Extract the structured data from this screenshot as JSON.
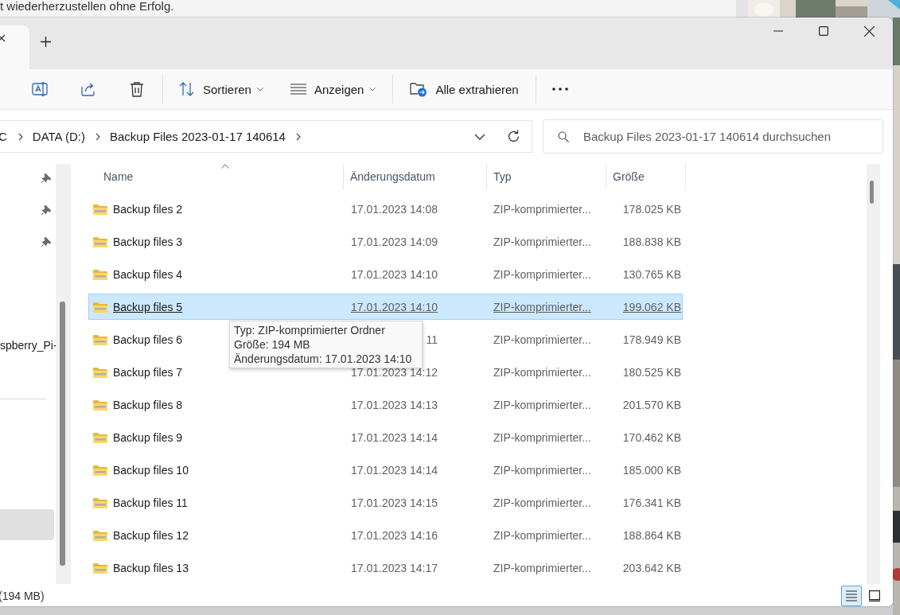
{
  "background": {
    "text": "t wiederherzustellen ohne Erfolg."
  },
  "toolbar": {
    "sort": {
      "label": "Sortieren"
    },
    "view": {
      "label": "Anzeigen"
    },
    "extract": {
      "label": "Alle extrahieren"
    }
  },
  "address": {
    "segments": [
      "C",
      "DATA (D:)",
      "Backup Files 2023-01-17 140614"
    ]
  },
  "search": {
    "placeholder": "Backup Files 2023-01-17 140614 durchsuchen"
  },
  "nav": {
    "items": [
      {
        "kind": "pinned",
        "selected": false
      },
      {
        "kind": "pinned",
        "selected": false
      },
      {
        "kind": "pinned",
        "selected": false
      },
      {
        "kind": "label",
        "label": "spberry_Pi-",
        "selected": false
      },
      {
        "kind": "divider"
      },
      {
        "kind": "blank",
        "selected": true
      }
    ]
  },
  "table": {
    "columns": [
      "Name",
      "Änderungsdatum",
      "Typ",
      "Größe"
    ],
    "rows": [
      {
        "name": "Backup files 2",
        "date": "17.01.2023 14:08",
        "type": "ZIP-komprimierter...",
        "size": "178.025 KB",
        "selected": false
      },
      {
        "name": "Backup files 3",
        "date": "17.01.2023 14:09",
        "type": "ZIP-komprimierter...",
        "size": "188.838 KB",
        "selected": false
      },
      {
        "name": "Backup files 4",
        "date": "17.01.2023 14:10",
        "type": "ZIP-komprimierter...",
        "size": "130.765 KB",
        "selected": false
      },
      {
        "name": "Backup files 5",
        "date": "17.01.2023 14:10",
        "type": "ZIP-komprimierter...",
        "size": "199.062 KB",
        "selected": true
      },
      {
        "name": "Backup files 6",
        "date": "11",
        "type": "ZIP-komprimierter...",
        "size": "178.949 KB",
        "selected": false
      },
      {
        "name": "Backup files 7",
        "date": "17.01.2023 14:12",
        "type": "ZIP-komprimierter...",
        "size": "180.525 KB",
        "selected": false
      },
      {
        "name": "Backup files 8",
        "date": "17.01.2023 14:13",
        "type": "ZIP-komprimierter...",
        "size": "201.570 KB",
        "selected": false
      },
      {
        "name": "Backup files 9",
        "date": "17.01.2023 14:14",
        "type": "ZIP-komprimierter...",
        "size": "170.462 KB",
        "selected": false
      },
      {
        "name": "Backup files 10",
        "date": "17.01.2023 14:14",
        "type": "ZIP-komprimierter...",
        "size": "185.000 KB",
        "selected": false
      },
      {
        "name": "Backup files 11",
        "date": "17.01.2023 14:15",
        "type": "ZIP-komprimierter...",
        "size": "176.341 KB",
        "selected": false
      },
      {
        "name": "Backup files 12",
        "date": "17.01.2023 14:16",
        "type": "ZIP-komprimierter...",
        "size": "188.864 KB",
        "selected": false
      },
      {
        "name": "Backup files 13",
        "date": "17.01.2023 14:17",
        "type": "ZIP-komprimierter...",
        "size": "203.642 KB",
        "selected": false
      }
    ]
  },
  "tooltip": {
    "lines": [
      "Typ: ZIP-komprimierter Ordner",
      "Größe: 194 MB",
      "Änderungsdatum: 17.01.2023 14:10"
    ]
  },
  "status_bar": {
    "text": "(194 MB)",
    "views": [
      {
        "selected": true
      },
      {
        "selected": false
      }
    ]
  }
}
